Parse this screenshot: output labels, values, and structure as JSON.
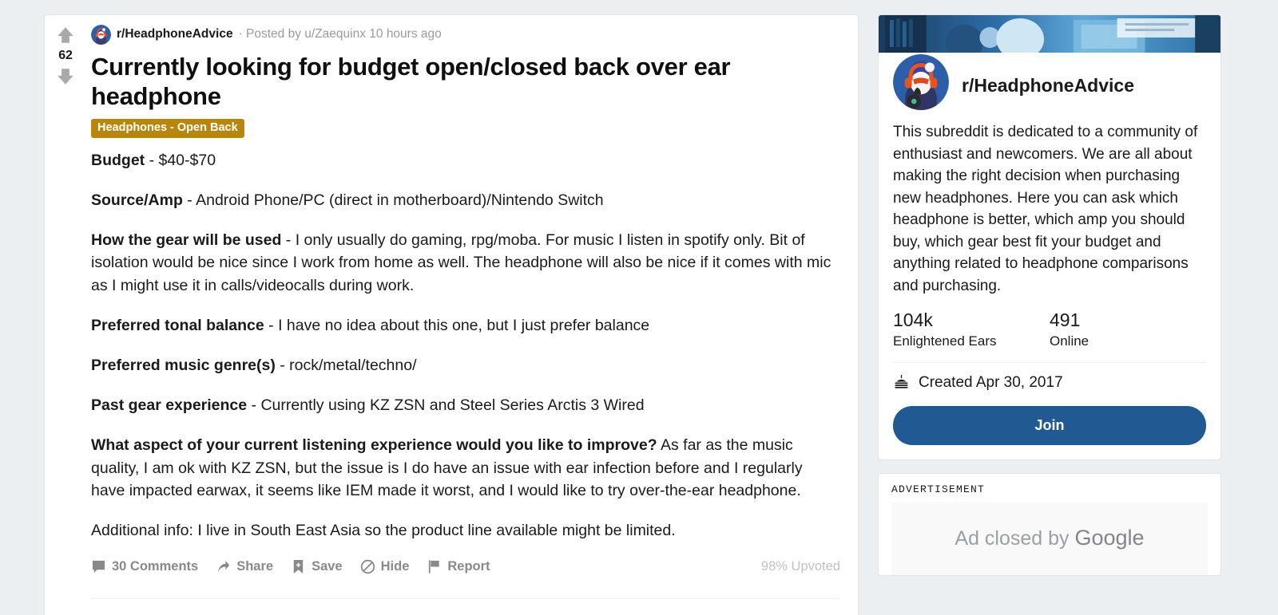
{
  "post": {
    "score": "62",
    "upvote_icon": "arrow-up-icon",
    "downvote_icon": "arrow-down-icon",
    "subreddit": "r/HeadphoneAdvice",
    "meta_rest": "· Posted by u/Zaequinx 10 hours ago",
    "title": "Currently looking for budget open/closed back over ear headphone",
    "flair": "Headphones - Open Back",
    "paragraphs": [
      {
        "label": "Budget",
        "text": " - $40-$70"
      },
      {
        "label": "Source/Amp",
        "text": " - Android Phone/PC (direct in motherboard)/Nintendo Switch"
      },
      {
        "label": "How the gear will be used",
        "text": " - I only usually do gaming, rpg/moba. For music I listen in spotify only. Bit of isolation would be nice since I work from home as well. The headphone will also be nice if it comes with mic as I might use it in calls/videocalls during work."
      },
      {
        "label": "Preferred tonal balance",
        "text": " - I have no idea about this one, but I just prefer balance"
      },
      {
        "label": "Preferred music genre(s)",
        "text": " - rock/metal/techno/"
      },
      {
        "label": "Past gear experience",
        "text": " - Currently using KZ ZSN and Steel Series Arctis 3 Wired"
      },
      {
        "label": "What aspect of your current listening experience would you like to improve?",
        "text": " As far as the music quality, I am ok with KZ ZSN, but the issue is I do have an issue with ear infection before and I regularly have impacted earwax, it seems like IEM made it worst, and I would like to try over-the-ear headphone."
      },
      {
        "label": "",
        "text": "Additional info: I live in South East Asia so the product line available might be limited."
      }
    ],
    "actions": [
      {
        "icon": "comment-icon",
        "label": "30 Comments"
      },
      {
        "icon": "share-icon",
        "label": "Share"
      },
      {
        "icon": "save-bookmark-icon",
        "label": "Save"
      },
      {
        "icon": "hide-icon",
        "label": "Hide"
      },
      {
        "icon": "report-flag-icon",
        "label": "Report"
      }
    ],
    "upvoted_pct": "98% Upvoted"
  },
  "sidebar": {
    "community": {
      "name": "r/HeadphoneAdvice",
      "description": "This subreddit is dedicated to a community of enthusiast and newcomers. We are all about making the right decision when purchasing new headphones. Here you can ask which headphone is better, which amp you should buy, which gear best fit your budget and anything related to headphone comparisons and purchasing.",
      "members_count": "104k",
      "members_label": "Enlightened Ears",
      "online_count": "491",
      "online_label": "Online",
      "cake_icon": "cake-icon",
      "created": "Created Apr 30, 2017",
      "join_label": "Join"
    },
    "ad": {
      "label": "ADVERTISEMENT",
      "closed_text": "Ad closed by ",
      "closed_brand": "Google"
    }
  },
  "colors": {
    "flair_bg": "#b8860b",
    "join_bg": "#215a92",
    "page_bg": "#eceff1",
    "muted_text": "#878a8c"
  }
}
